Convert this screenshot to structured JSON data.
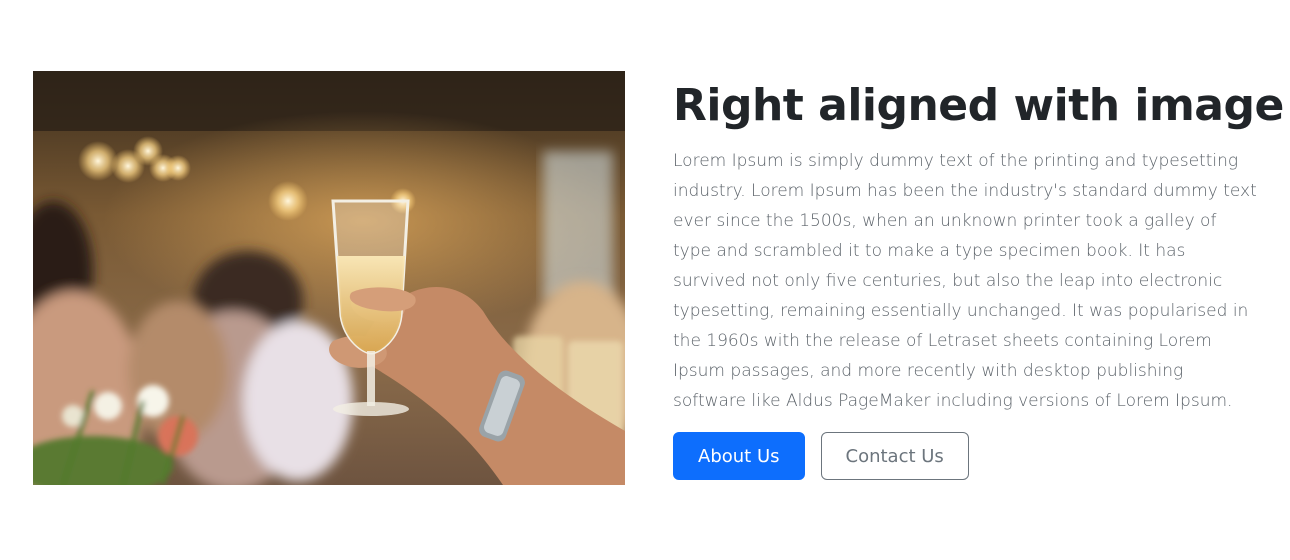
{
  "hero": {
    "title": "Right aligned with image",
    "body": "Lorem Ipsum is simply dummy text of the printing and typesetting industry. Lorem Ipsum has been the industry's standard dummy text ever since the 1500s, when an unknown printer took a galley of type and scrambled it to make a type specimen book. It has survived not only five centuries, but also the leap into electronic typesetting, remaining essentially unchanged. It was popularised in the 1960s with the release of Letraset sheets containing Lorem Ipsum passages, and more recently with desktop publishing software like Aldus PageMaker including versions of Lorem Ipsum.",
    "primary_button": "About Us",
    "secondary_button": "Contact Us"
  },
  "colors": {
    "primary": "#0d6efd",
    "heading": "#212529",
    "muted": "#6c757d"
  }
}
